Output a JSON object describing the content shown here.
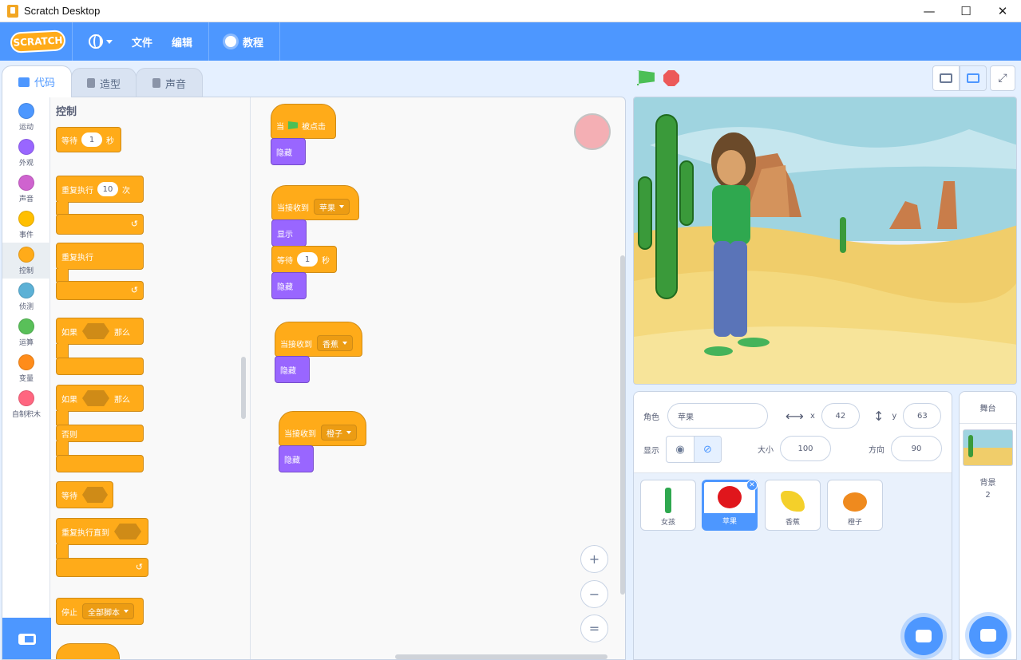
{
  "window": {
    "title": "Scratch Desktop",
    "min": "—",
    "max": "☐",
    "close": "✕"
  },
  "menu": {
    "logo": "SCRATCH",
    "file": "文件",
    "edit": "编辑",
    "tutorials": "教程"
  },
  "tabs": {
    "code": "代码",
    "costumes": "造型",
    "sounds": "声音"
  },
  "categories": [
    {
      "label": "运动",
      "color": "#4c97ff"
    },
    {
      "label": "外观",
      "color": "#9966ff"
    },
    {
      "label": "声音",
      "color": "#cf63cf"
    },
    {
      "label": "事件",
      "color": "#ffbf00"
    },
    {
      "label": "控制",
      "color": "#ffab19"
    },
    {
      "label": "侦测",
      "color": "#5cb1d6"
    },
    {
      "label": "运算",
      "color": "#59c059"
    },
    {
      "label": "变量",
      "color": "#ff8c1a"
    },
    {
      "label": "自制积木",
      "color": "#ff6680"
    }
  ],
  "palette": {
    "title": "控制",
    "wait": "等待",
    "wait_val": "1",
    "wait_unit": "秒",
    "repeat": "重复执行",
    "repeat_val": "10",
    "repeat_unit": "次",
    "forever": "重复执行",
    "if": "如果",
    "then": "那么",
    "if2": "如果",
    "then2": "那么",
    "else": "否则",
    "wait_until": "等待",
    "repeat_until": "重复执行直到",
    "stop": "停止",
    "stop_opt": "全部脚本"
  },
  "scripts": {
    "s1_when": "当",
    "s1_clicked": "被点击",
    "s1_hide": "隐藏",
    "s2_receive": "当接收到",
    "s2_msg": "苹果",
    "s2_show": "显示",
    "s2_wait": "等待",
    "s2_wait_val": "1",
    "s2_wait_unit": "秒",
    "s2_hide": "隐藏",
    "s3_receive": "当接收到",
    "s3_msg": "香蕉",
    "s3_hide": "隐藏",
    "s4_receive": "当接收到",
    "s4_msg": "橙子",
    "s4_hide": "隐藏"
  },
  "zoom": {
    "in": "+",
    "out": "−",
    "reset": "="
  },
  "sprite_info": {
    "sprite_label": "角色",
    "sprite_name": "苹果",
    "x_label": "x",
    "x": "42",
    "y_label": "y",
    "y": "63",
    "show_label": "显示",
    "size_label": "大小",
    "size": "100",
    "direction_label": "方向",
    "direction": "90"
  },
  "sprites": [
    {
      "name": "女孩"
    },
    {
      "name": "苹果"
    },
    {
      "name": "香蕉"
    },
    {
      "name": "橙子"
    }
  ],
  "stage_pane": {
    "title": "舞台",
    "backdrop_label": "背景",
    "backdrop_count": "2"
  }
}
